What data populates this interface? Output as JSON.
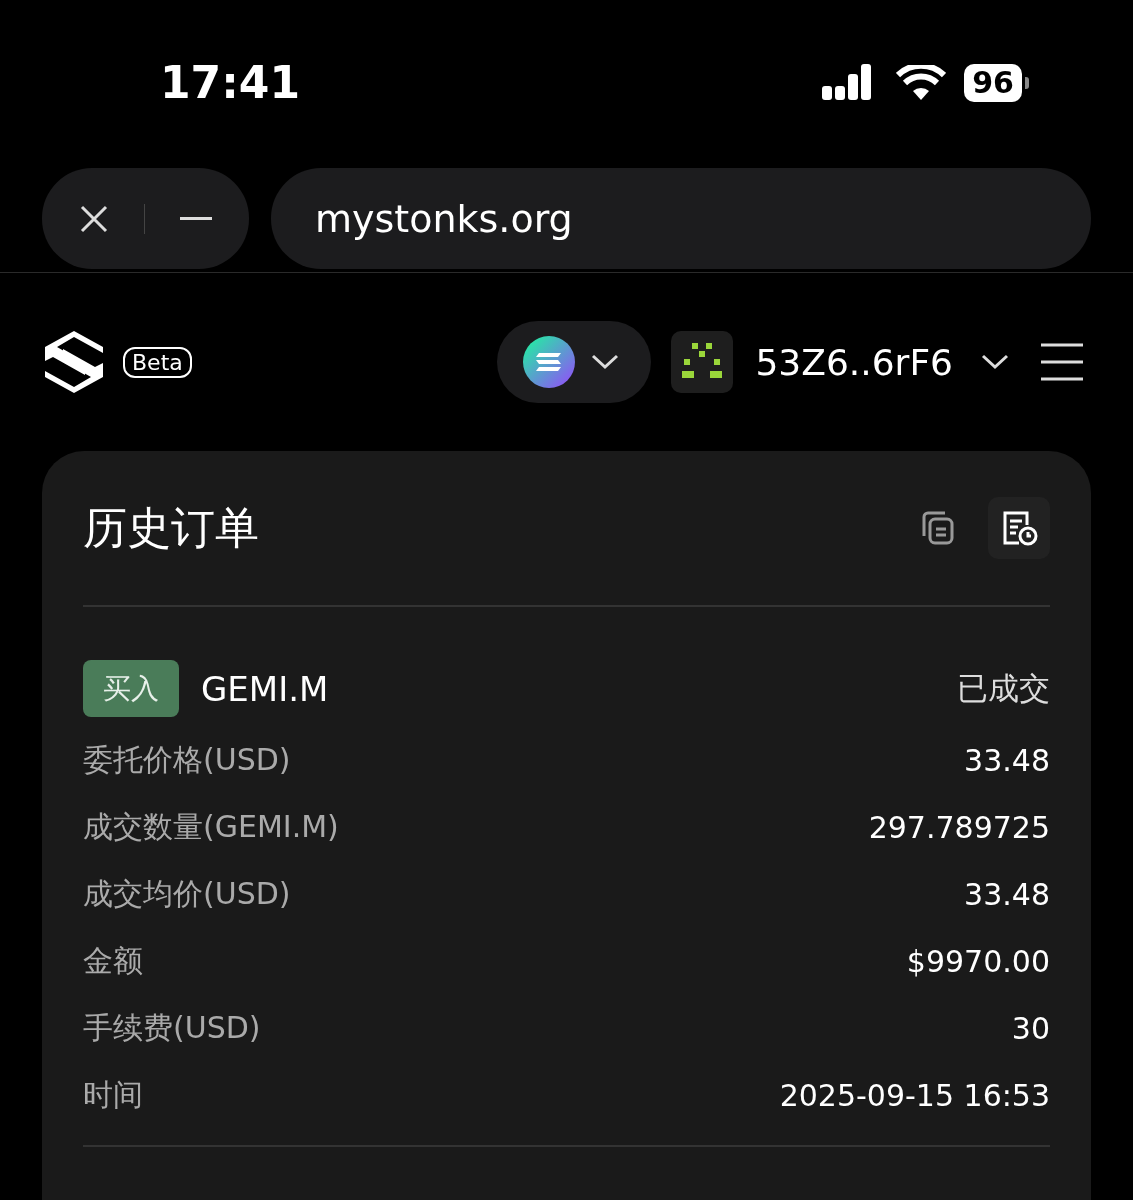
{
  "status_bar": {
    "time": "17:41",
    "battery": "96"
  },
  "browser": {
    "url": "mystonks.org"
  },
  "header": {
    "badge": "Beta",
    "wallet": "53Z6..6rF6"
  },
  "card": {
    "title": "历史订单",
    "views": [
      {
        "selected": false
      },
      {
        "selected": true
      }
    ],
    "order": {
      "side": "买入",
      "symbol": "GEMI.M",
      "status": "已成交",
      "fields": [
        {
          "label": "委托价格(USD)",
          "value": "33.48"
        },
        {
          "label": "成交数量(GEMI.M)",
          "value": "297.789725"
        },
        {
          "label": "成交均价(USD)",
          "value": "33.48"
        },
        {
          "label": "金额",
          "value": "$9970.00"
        },
        {
          "label": "手续费(USD)",
          "value": "30"
        },
        {
          "label": "时间",
          "value": "2025-09-15 16:53"
        }
      ]
    }
  }
}
